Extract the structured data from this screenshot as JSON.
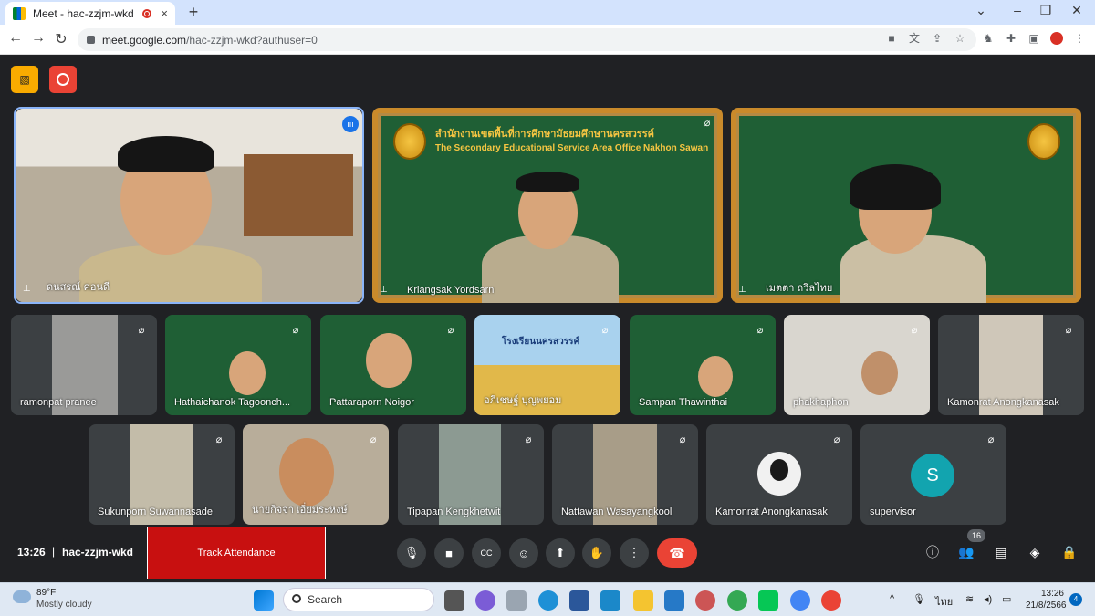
{
  "browser": {
    "tab_title": "Meet - hac-zzjm-wkd",
    "tab_close": "×",
    "new_tab": "+",
    "url_host": "meet.google.com",
    "url_path": "/hac-zzjm-wkd?authuser=0",
    "win_min": "⌄",
    "win_minimize": "–",
    "win_max": "❐",
    "win_close": "✕"
  },
  "participants_main": [
    {
      "name": "ดนสรณ์ คอนดี"
    },
    {
      "name": "Kriangsak Yordsarn"
    },
    {
      "name": "เมตตา ถวิลไทย"
    }
  ],
  "board": {
    "title_th": "สำนักงานเขตพื้นที่การศึกษามัธยมศึกษานครสวรรค์",
    "title_en": "The Secondary Educational Service Area Office Nakhon Sawan"
  },
  "participants_row2": [
    {
      "name": "ramonpat pranee"
    },
    {
      "name": "Hathaichanok Tagoonch..."
    },
    {
      "name": "Pattaraporn Noigor"
    },
    {
      "name": "อภิเชษฐ์ บุญพยอม"
    },
    {
      "name": "Sampan Thawinthai"
    },
    {
      "name": "phakhaphon"
    },
    {
      "name": "Kamonrat Anongkanasak"
    }
  ],
  "participants_row3": [
    {
      "name": "Sukunporn Suwannasade"
    },
    {
      "name": "นายกิจจา เอี่ยมระหงษ์"
    },
    {
      "name": "Tipapan Kengkhetwit"
    },
    {
      "name": "Nattawan Wasayangkool"
    },
    {
      "name": "Kamonrat Anongkanasak"
    },
    {
      "name": "supervisor",
      "initial": "S",
      "color": "#12a4af"
    }
  ],
  "school_banner": "โรงเรียนนครสวรรค์",
  "bottom": {
    "time": "13:26",
    "separator": "|",
    "meeting_code": "hac-zzjm-wkd",
    "track_attendance": "Track Attendance",
    "participant_count": "16"
  },
  "taskbar": {
    "temp": "89°F",
    "condition": "Mostly cloudy",
    "search_label": "Search",
    "lang": "ไทย",
    "clock_time": "13:26",
    "clock_date": "21/8/2566",
    "notifications": "4"
  },
  "colors": {
    "accent_blue": "#8ab4f8",
    "end_call": "#ea4335",
    "attendance": "#c81010"
  }
}
